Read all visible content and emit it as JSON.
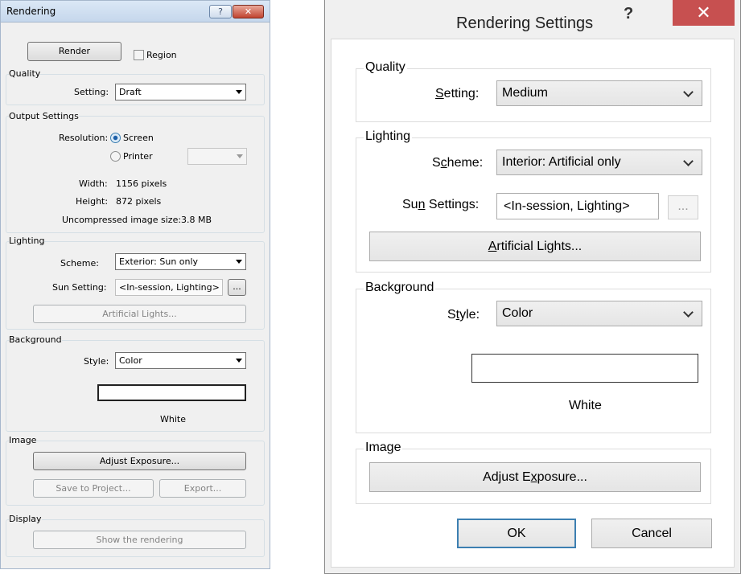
{
  "left": {
    "title": "Rendering",
    "help": "?",
    "close": "✕",
    "render_button": "Render",
    "region_label": "Region",
    "quality": {
      "label": "Quality",
      "setting_label": "Setting:",
      "setting_value": "Draft"
    },
    "output": {
      "label": "Output Settings",
      "resolution_label": "Resolution:",
      "screen_label": "Screen",
      "printer_label": "Printer",
      "width_label": "Width:",
      "width_value": "1156 pixels",
      "height_label": "Height:",
      "height_value": "872 pixels",
      "size_label": "Uncompressed image size:",
      "size_value": "3.8 MB"
    },
    "lighting": {
      "label": "Lighting",
      "scheme_label": "Scheme:",
      "scheme_value": "Exterior: Sun only",
      "sun_label": "Sun Setting:",
      "sun_value": "<In-session, Lighting>",
      "ellipsis": "...",
      "artificial_button": "Artificial Lights..."
    },
    "background": {
      "label": "Background",
      "style_label": "Style:",
      "style_value": "Color",
      "color_name": "White"
    },
    "image": {
      "label": "Image",
      "adjust_button": "Adjust Exposure...",
      "save_button": "Save to Project...",
      "export_button": "Export..."
    },
    "display": {
      "label": "Display",
      "show_button": "Show the rendering"
    }
  },
  "right": {
    "title": "Rendering Settings",
    "help": "?",
    "close": "✕",
    "quality": {
      "label": "Quality",
      "setting_label_pre": "",
      "setting_label_u": "S",
      "setting_label_post": "etting:",
      "setting_value": "Medium"
    },
    "lighting": {
      "label": "Lighting",
      "scheme_pre": "S",
      "scheme_u": "c",
      "scheme_post": "heme:",
      "scheme_value": "Interior: Artificial only",
      "sun_pre": "Su",
      "sun_u": "n",
      "sun_post": " Settings:",
      "sun_value": "<In-session, Lighting>",
      "ellipsis": "...",
      "art_u": "A",
      "art_post": "rtificial Lights..."
    },
    "background": {
      "label": "Background",
      "style_pre": "S",
      "style_u": "t",
      "style_post": "yle:",
      "style_value": "Color",
      "color_name": "White"
    },
    "image": {
      "label": "Image",
      "adj_pre": "Adjust E",
      "adj_u": "x",
      "adj_post": "posure..."
    },
    "ok_button": "OK",
    "cancel_button": "Cancel"
  },
  "colors": {
    "left_close": "#c1432f",
    "right_close": "#c75050",
    "swatch": "#ffffff"
  }
}
